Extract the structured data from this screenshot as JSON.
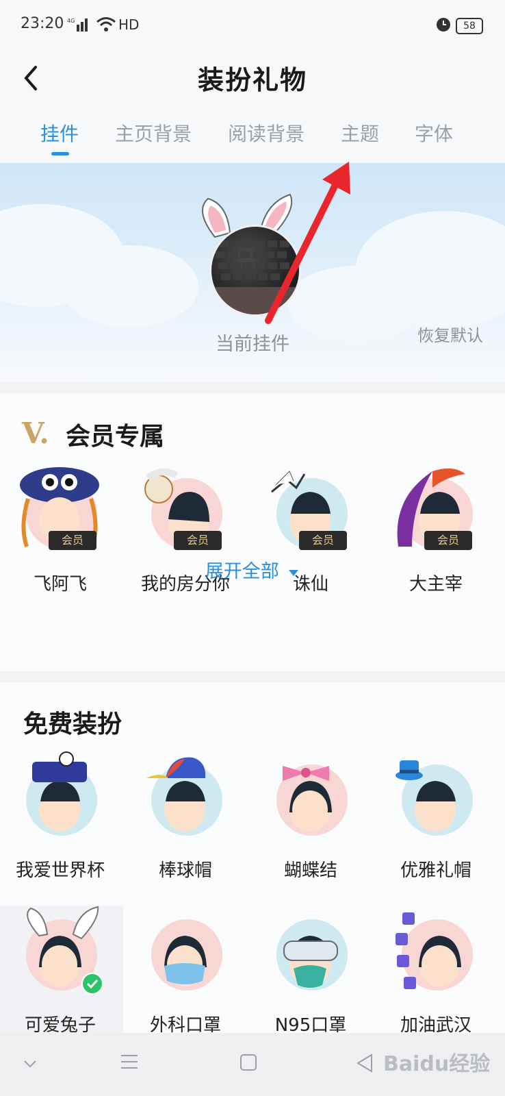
{
  "status_bar": {
    "time": "23:20",
    "network": "HD",
    "battery": "58"
  },
  "header": {
    "title": "装扮礼物"
  },
  "tabs": [
    {
      "label": "挂件",
      "active": true
    },
    {
      "label": "主页背景",
      "active": false
    },
    {
      "label": "阅读背景",
      "active": false
    },
    {
      "label": "主题",
      "active": false
    },
    {
      "label": "字体",
      "active": false
    }
  ],
  "banner": {
    "current_label": "当前挂件",
    "restore_label": "恢复默认"
  },
  "vip_section": {
    "title": "会员专属",
    "badge": "会员",
    "items": [
      {
        "label": "飞阿飞"
      },
      {
        "label": "我的房分你"
      },
      {
        "label": "诛仙"
      },
      {
        "label": "大主宰"
      }
    ],
    "expand_label": "展开全部"
  },
  "free_section": {
    "title": "免费装扮",
    "items": [
      {
        "label": "我爱世界杯"
      },
      {
        "label": "棒球帽"
      },
      {
        "label": "蝴蝶结"
      },
      {
        "label": "优雅礼帽"
      },
      {
        "label": "可爱兔子"
      },
      {
        "label": "外科口罩"
      },
      {
        "label": "N95口罩"
      },
      {
        "label": "加油武汉"
      }
    ]
  },
  "watermark": "Baidu经验",
  "colors": {
    "accent": "#2b8fe0",
    "vip_gold": "#c9a565",
    "arrow": "#e8262b"
  }
}
